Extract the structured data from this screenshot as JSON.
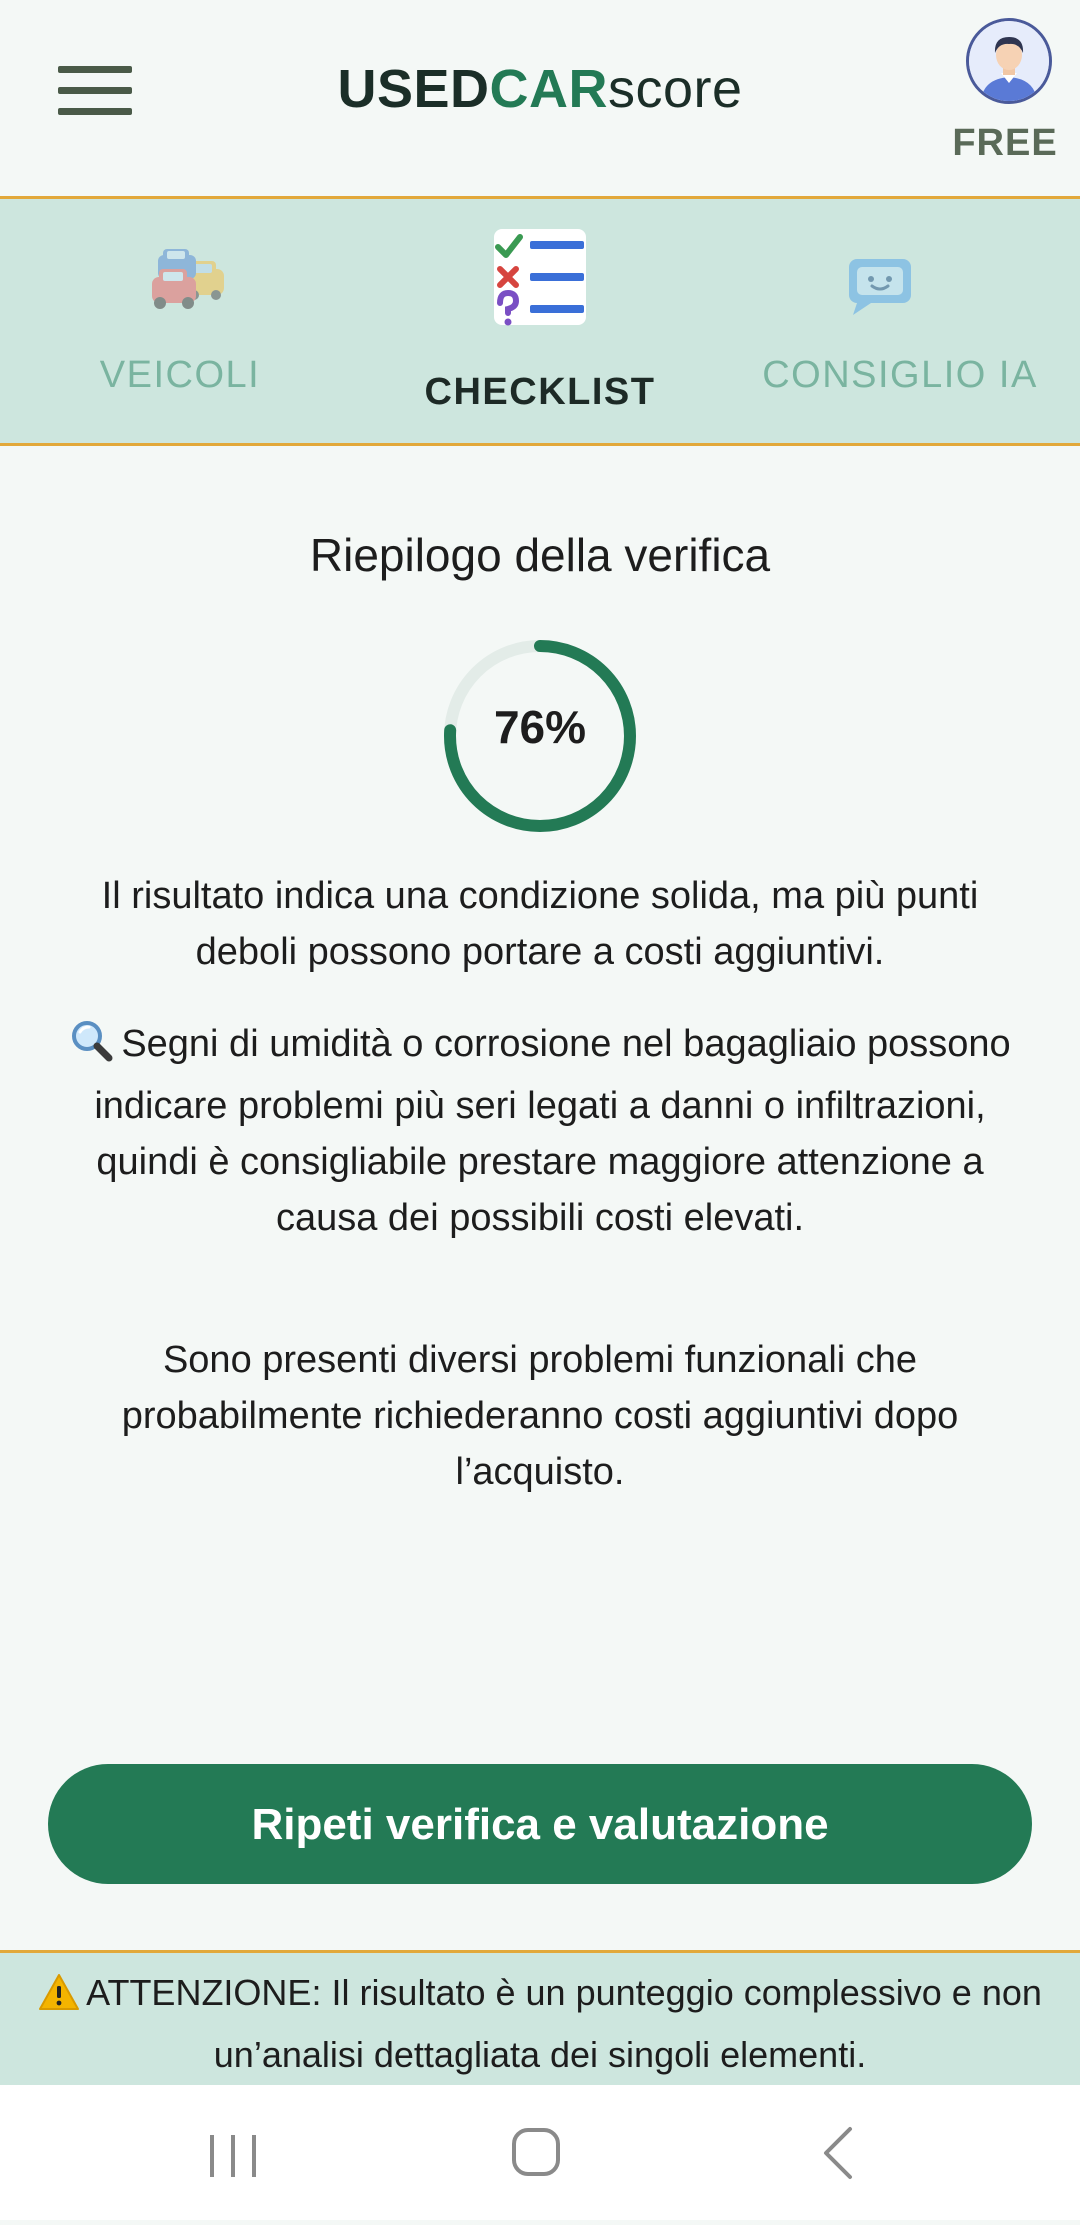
{
  "header": {
    "logo": {
      "part1": "USED",
      "part2": "CAR",
      "part3": "score"
    },
    "plan_badge": "FREE",
    "menu_icon": "hamburger-menu-icon",
    "avatar_icon": "user-avatar-icon"
  },
  "tabs": [
    {
      "label": "VEICOLI",
      "icon": "cars-icon",
      "active": false
    },
    {
      "label": "CHECKLIST",
      "icon": "checklist-icon",
      "active": true
    },
    {
      "label": "CONSIGLIO IA",
      "icon": "chatbot-icon",
      "active": false
    }
  ],
  "summary": {
    "title": "Riepilogo della verifica",
    "score_label": "76%",
    "score_percent": 76,
    "paragraph1": "Il risultato indica una condizione solida, ma più punti deboli possono portare a costi aggiuntivi.",
    "paragraph2": "Segni di umidità o corrosione nel bagagliaio possono indicare problemi più seri legati a danni o infiltrazioni, quindi è consigliabile prestare maggiore attenzione a causa dei possibili costi elevati.",
    "paragraph2_icon": "magnifying-glass-icon",
    "paragraph3": "Sono presenti diversi problemi funzionali che probabilmente richiederanno costi aggiuntivi dopo l’acquisto."
  },
  "actions": {
    "repeat_label": "Ripeti verifica e valutazione"
  },
  "warning": {
    "icon": "warning-icon",
    "text": "ATTENZIONE: Il risultato è un punteggio complessivo e non un’analisi dettagliata dei singoli elementi."
  },
  "colors": {
    "accent": "#237a55",
    "tab_bg": "#cde6de",
    "divider": "#e2a83a",
    "background": "#f4f8f6"
  }
}
